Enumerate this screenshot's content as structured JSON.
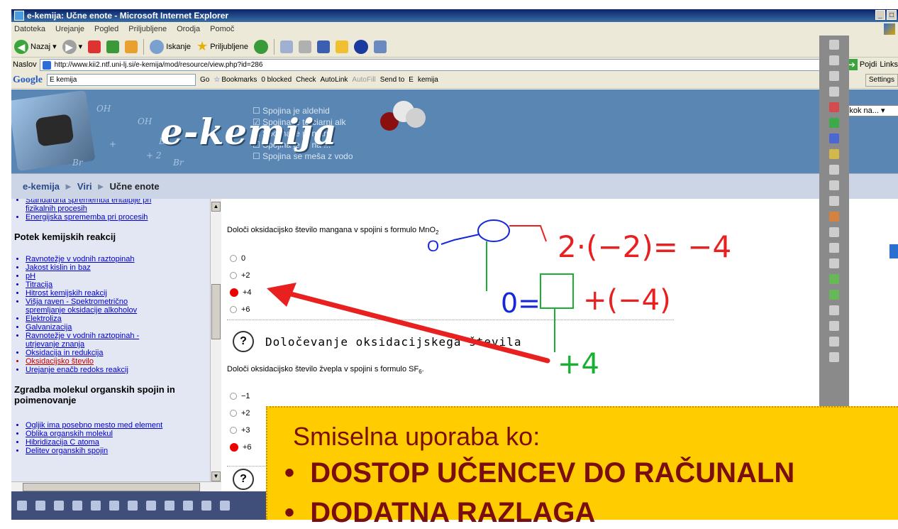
{
  "window": {
    "title": "e-kemija: Učne enote - Microsoft Internet Explorer",
    "controls": [
      "_",
      "□"
    ]
  },
  "menu": [
    "Datoteka",
    "Urejanje",
    "Pogled",
    "Priljubljene",
    "Orodja",
    "Pomoč"
  ],
  "toolbar": {
    "back": "Nazaj",
    "search": "Iskanje",
    "favorites": "Priljubljene"
  },
  "address": {
    "label": "Naslov",
    "url": "http://www.kii2.ntf.uni-lj.si/e-kemija/mod/resource/view.php?id=286",
    "go": "Pojdi",
    "links": "Links"
  },
  "googlebar": {
    "logo": "Google",
    "search": "E kemija",
    "go": "Go",
    "bookmarks": "Bookmarks",
    "blocked": "0 blocked",
    "check": "Check",
    "autolink": "AutoLink",
    "autofill": "AutoFill",
    "sendto": "Send to",
    "e": "E",
    "kemija": "kemija",
    "settings": "Settings"
  },
  "header": {
    "logo": "e-kemija",
    "checks": [
      "Spojina je aldehid",
      "Spojina je terciarni alk",
      "Spojina je primarni",
      "Spojina je ... na ...",
      "Spojina se meša z vodo"
    ],
    "chem": [
      "OH",
      "OH",
      "Br",
      "Br",
      "+",
      "+ 2",
      "Br"
    ],
    "jump": "Skok na..."
  },
  "breadcrumb": {
    "home": "e-kemija",
    "sep": "►",
    "viri": "Viri",
    "current": "Učne enote"
  },
  "sidebar": {
    "top_items": [
      "Standardna sprememba entalpije pri",
      "fizikalnih procesih",
      "Energijska sprememba pri procesih"
    ],
    "section1": "Potek kemijskih reakcij",
    "items1": [
      "Ravnotežje v vodnih raztopinah",
      "Jakost kislin in baz",
      "pH",
      "Titracija",
      "Hitrost kemijskih reakcij",
      "Višja raven - Spektrometrično",
      "spremljanje oksidacije alkoholov",
      "Elektroliza",
      "Galvanizacija",
      "Ravnotežje v vodnih raztopinah -",
      "utrjevanje znanja",
      "Oksidacija in redukcija",
      "Oksidacijsko število",
      "Urejanje enačb redoks reakcij"
    ],
    "section2": "Zgradba molekul organskih spojin in poimenovanje",
    "items2": [
      "Ogljik ima posebno mesto med element",
      "Oblika organskih molekul",
      "Hibridizacija C atoma",
      "Delitev organskih spojin"
    ]
  },
  "content": {
    "q1_text": "Določi oksidacijsko število mangana v spojini s formulo MnO",
    "q1_sub": "2",
    "q1_options": [
      "0",
      "+2",
      "+4",
      "+6"
    ],
    "q2_badge": "?",
    "q2_title": "Določevanje oksidacijskega števila",
    "q2_text": "Določi oksidacijsko število žvepla v spojini s formulo SF",
    "q2_sub": "6",
    "q2_text_end": ".",
    "q2_options": [
      "−1",
      "+2",
      "+3",
      "+6"
    ],
    "q3_badge": "?"
  },
  "handwriting": {
    "o_label": "O",
    "eq1": "2·(−2)= −4",
    "eq2_left": "0=",
    "eq2_right": "+(−4)",
    "result": "+4"
  },
  "overlay": {
    "title": "Smiselna uporaba ko:",
    "bullet": "•",
    "b1": "DOSTOP UČENCEV DO RAČUNALN",
    "b2": "DODATNA RAZLAGA"
  },
  "colors": {
    "overlay_bg": "#ffcc00",
    "overlay_text": "#7a0d0d",
    "header_blue": "#5a86b4",
    "pen_red": "#e82020",
    "pen_green": "#18b030",
    "pen_blue": "#1428d8"
  }
}
